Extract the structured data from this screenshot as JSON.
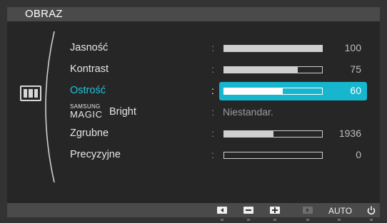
{
  "menu": {
    "title": "OBRAZ",
    "icon": "picture-menu-icon"
  },
  "items": [
    {
      "label": "Jasność",
      "value": "100",
      "level": 1.0,
      "selected": false
    },
    {
      "label": "Kontrast",
      "value": "75",
      "level": 0.75,
      "selected": false
    },
    {
      "label": "Ostrość",
      "value": "60",
      "level": 0.6,
      "selected": true
    },
    {
      "label_brand_top": "SAMSUNG",
      "label_brand_bottom": "MAGIC",
      "label_word": "Bright",
      "value_text": "Niestandar."
    },
    {
      "label": "Zgrubne",
      "value": "1936",
      "level": 0.5,
      "selected": false
    },
    {
      "label": "Precyzyjne",
      "value": "0",
      "level": 0.0,
      "selected": false
    }
  ],
  "colon": ":",
  "buttons": {
    "left_icon": "left-arrow-icon",
    "minus_icon": "minus-icon",
    "plus_icon": "plus-icon",
    "enter_icon": "enter-icon",
    "auto_label": "AUTO",
    "power_icon": "power-icon"
  },
  "colors": {
    "highlight": "#17b6cf",
    "selected_label": "#1fc3dc",
    "panel": "#262626"
  }
}
